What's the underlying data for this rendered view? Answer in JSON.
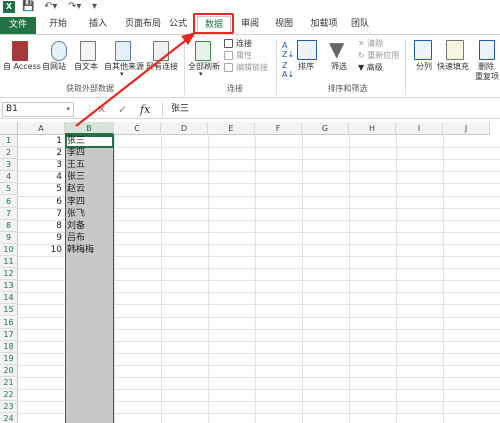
{
  "qat": {
    "app_icon": "X",
    "save_icon": "save-icon",
    "undo_icon": "undo-icon",
    "redo_icon": "redo-icon"
  },
  "tabs": [
    {
      "label": "文件"
    },
    {
      "label": "开始"
    },
    {
      "label": "插入"
    },
    {
      "label": "页面布局"
    },
    {
      "label": "公式"
    },
    {
      "label": "数据"
    },
    {
      "label": "审阅"
    },
    {
      "label": "视图"
    },
    {
      "label": "加载项"
    },
    {
      "label": "团队"
    }
  ],
  "ribbon": {
    "get_external": {
      "access": "自 Access",
      "web": "自网站",
      "text": "自文本",
      "other": "自其他来源",
      "existing": "现有连接",
      "group": "获取外部数据"
    },
    "connections": {
      "refresh_all": "全部刷新",
      "connections": "连接",
      "properties": "属性",
      "edit_links": "编辑链接",
      "group": "连接"
    },
    "sort_filter": {
      "sort": "排序",
      "filter": "筛选",
      "clear": "清除",
      "reapply": "重新应用",
      "advanced": "高级",
      "group": "排序和筛选"
    },
    "data_tools": {
      "text_to_columns": "分列",
      "flash_fill": "快速填充",
      "remove_dup_line1": "删除",
      "remove_dup_line2": "重复项"
    }
  },
  "formula_bar": {
    "name_box": "B1",
    "cancel_icon": "✕",
    "enter_icon": "✓",
    "fx_label": "fx",
    "content": "张三"
  },
  "grid": {
    "columns": [
      "A",
      "B",
      "C",
      "D",
      "E",
      "F",
      "G",
      "H",
      "I",
      "J"
    ],
    "selected_column": "B",
    "rows": [
      {
        "n": "1",
        "a": "1",
        "b": "张三"
      },
      {
        "n": "2",
        "a": "2",
        "b": "李四"
      },
      {
        "n": "3",
        "a": "3",
        "b": "王五"
      },
      {
        "n": "4",
        "a": "4",
        "b": "张三"
      },
      {
        "n": "5",
        "a": "5",
        "b": "赵云"
      },
      {
        "n": "6",
        "a": "6",
        "b": "李四"
      },
      {
        "n": "7",
        "a": "7",
        "b": "张飞"
      },
      {
        "n": "8",
        "a": "8",
        "b": "刘备"
      },
      {
        "n": "9",
        "a": "9",
        "b": "吕布"
      },
      {
        "n": "10",
        "a": "10",
        "b": "韩梅梅"
      },
      {
        "n": "11",
        "a": "",
        "b": ""
      },
      {
        "n": "12",
        "a": "",
        "b": ""
      },
      {
        "n": "13",
        "a": "",
        "b": ""
      },
      {
        "n": "14",
        "a": "",
        "b": ""
      },
      {
        "n": "15",
        "a": "",
        "b": ""
      },
      {
        "n": "16",
        "a": "",
        "b": ""
      },
      {
        "n": "17",
        "a": "",
        "b": ""
      },
      {
        "n": "18",
        "a": "",
        "b": ""
      },
      {
        "n": "19",
        "a": "",
        "b": ""
      },
      {
        "n": "20",
        "a": "",
        "b": ""
      },
      {
        "n": "21",
        "a": "",
        "b": ""
      },
      {
        "n": "22",
        "a": "",
        "b": ""
      },
      {
        "n": "23",
        "a": "",
        "b": ""
      },
      {
        "n": "24",
        "a": "",
        "b": ""
      }
    ]
  },
  "colors": {
    "excel_green": "#217346",
    "highlight_red": "#e8271f",
    "selection_gray": "#c8c8c8"
  }
}
